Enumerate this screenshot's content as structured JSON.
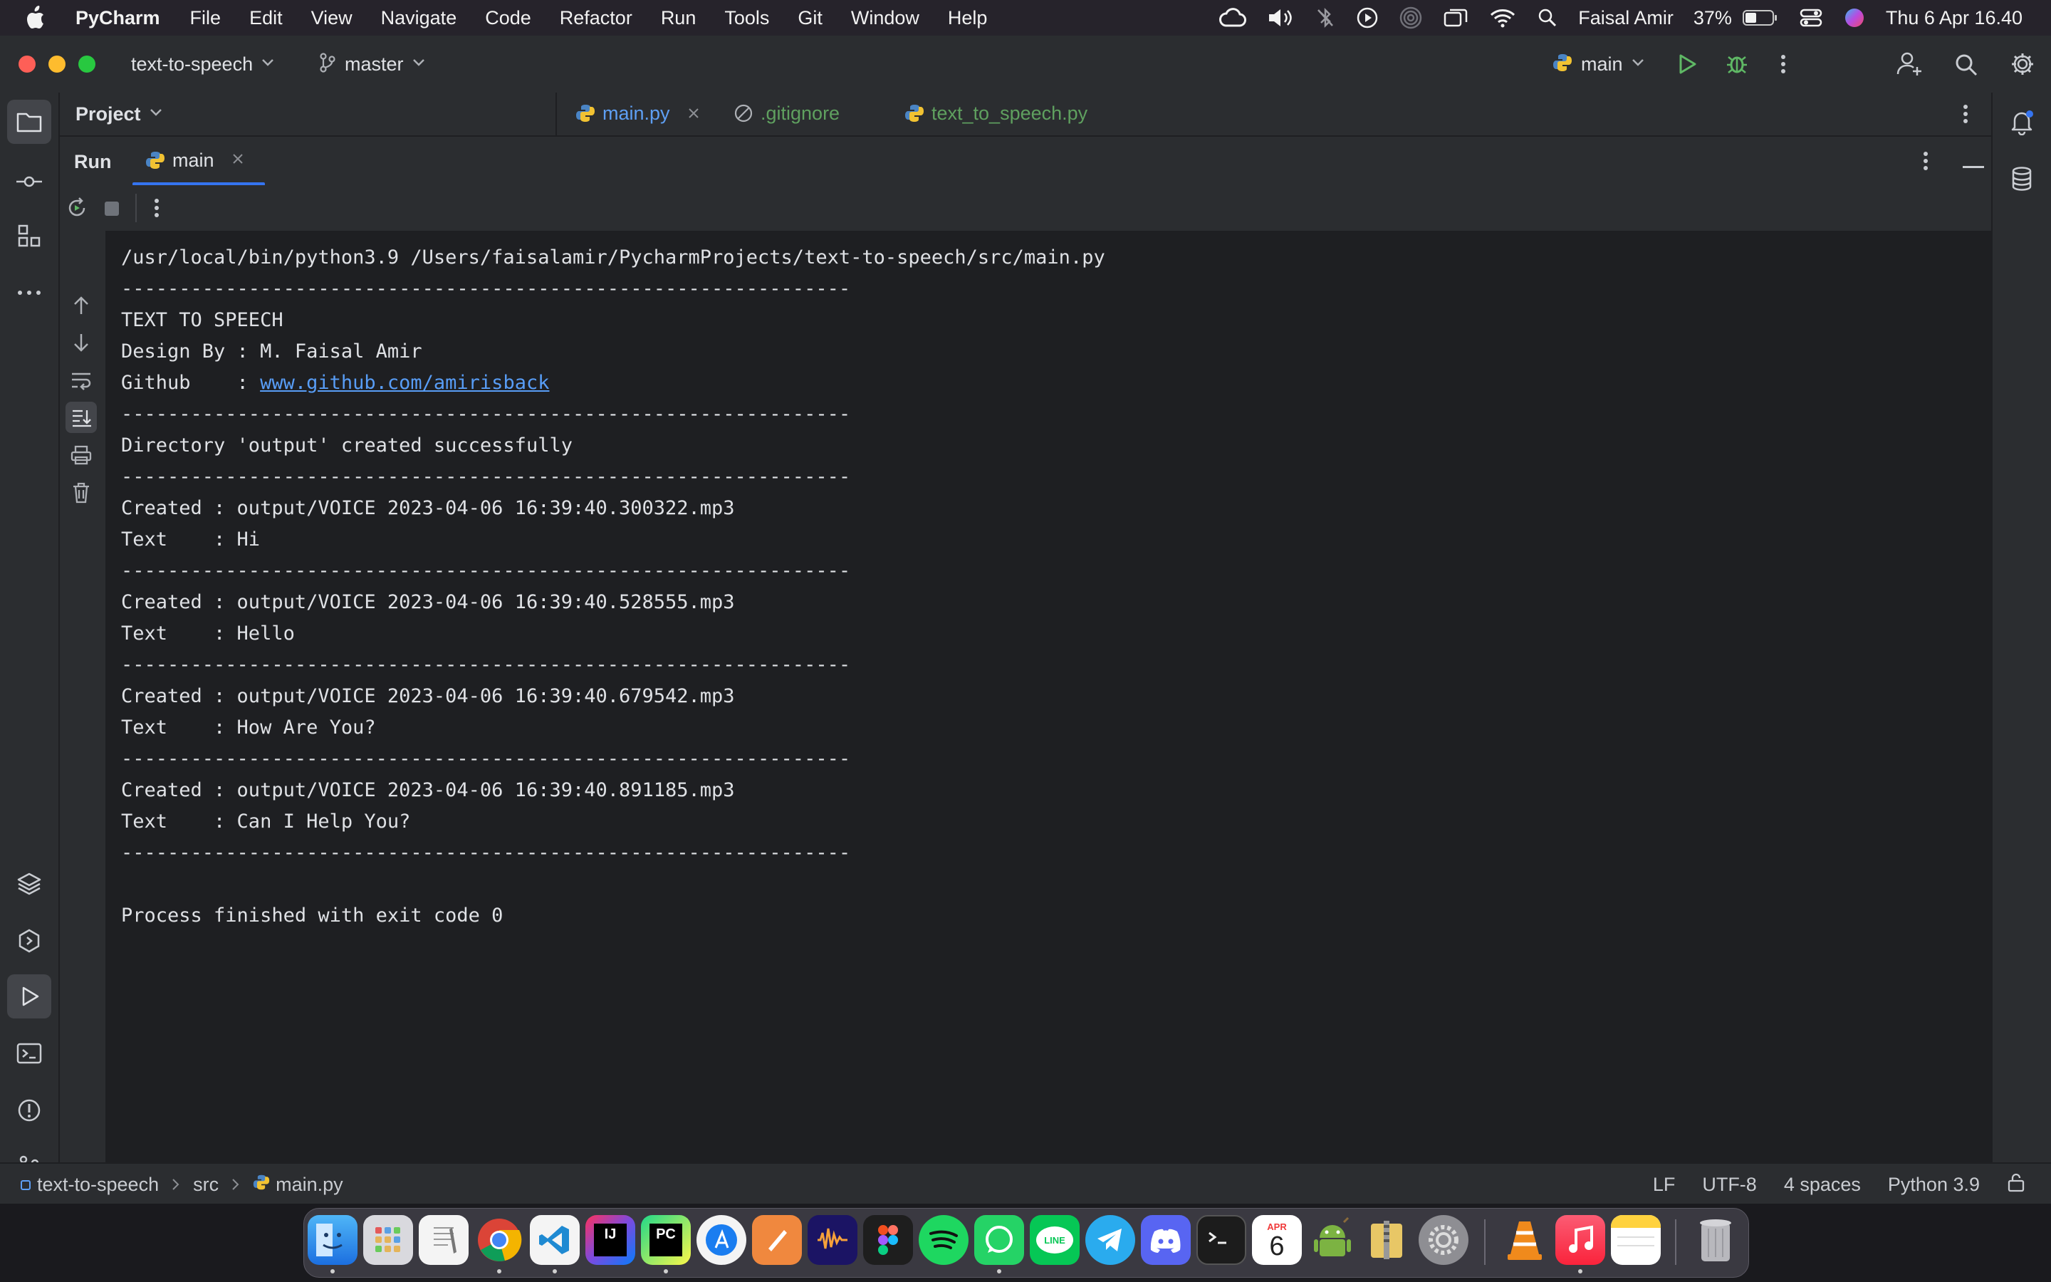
{
  "menubar": {
    "app_name": "PyCharm",
    "menus": [
      "File",
      "Edit",
      "View",
      "Navigate",
      "Code",
      "Refactor",
      "Run",
      "Tools",
      "Git",
      "Window",
      "Help"
    ],
    "user_name": "Faisal Amir",
    "battery_percent": "37%",
    "datetime": "Thu 6 Apr  16.40"
  },
  "titlebar": {
    "project_name": "text-to-speech",
    "branch": "master",
    "run_config": "main"
  },
  "project_panel": {
    "title": "Project"
  },
  "editor_tabs": [
    {
      "label": "main.py",
      "icon": "python-file-icon"
    },
    {
      "label": ".gitignore",
      "icon": "ignore-file-icon"
    },
    {
      "label": "text_to_speech.py",
      "icon": "python-file-icon"
    }
  ],
  "run_panel": {
    "title": "Run",
    "tab_label": "main"
  },
  "console": {
    "lines": [
      "/usr/local/bin/python3.9 /Users/faisalamir/PycharmProjects/text-to-speech/src/main.py",
      "---------------------------------------------------------------",
      "TEXT TO SPEECH",
      "Design By : M. Faisal Amir",
      "Github    : ",
      "---------------------------------------------------------------",
      "Directory 'output' created successfully",
      "---------------------------------------------------------------",
      "Created : output/VOICE 2023-04-06 16:39:40.300322.mp3",
      "Text    : Hi",
      "---------------------------------------------------------------",
      "Created : output/VOICE 2023-04-06 16:39:40.528555.mp3",
      "Text    : Hello",
      "---------------------------------------------------------------",
      "Created : output/VOICE 2023-04-06 16:39:40.679542.mp3",
      "Text    : How Are You?",
      "---------------------------------------------------------------",
      "Created : output/VOICE 2023-04-06 16:39:40.891185.mp3",
      "Text    : Can I Help You?",
      "---------------------------------------------------------------",
      "",
      "Process finished with exit code 0"
    ],
    "github_link": "www.github.com/amirisback"
  },
  "statusbar": {
    "breadcrumbs": [
      "text-to-speech",
      "src",
      "main.py"
    ],
    "line_separator": "LF",
    "encoding": "UTF-8",
    "indent": "4 spaces",
    "interpreter": "Python 3.9"
  },
  "dock": {
    "calendar_month": "APR",
    "calendar_day": "6",
    "apps": [
      "finder-icon",
      "launchpad-icon",
      "textedit-icon",
      "chrome-icon",
      "vscode-icon",
      "intellij-icon",
      "pycharm-icon",
      "xcode-icon",
      "sketch-icon",
      "audition-icon",
      "figma-icon",
      "spotify-icon",
      "whatsapp-icon",
      "line-icon",
      "telegram-icon",
      "discord-icon",
      "terminal-icon",
      "calendar-icon",
      "android-icon",
      "archive-icon",
      "system-preferences-icon",
      "vlc-icon",
      "music-icon",
      "notes-icon",
      "trash-icon"
    ]
  },
  "colors": {
    "accent": "#3574f0",
    "run_green": "#5fb865",
    "link": "#589df6",
    "background": "#1e1f22",
    "panel": "#2b2d30"
  }
}
